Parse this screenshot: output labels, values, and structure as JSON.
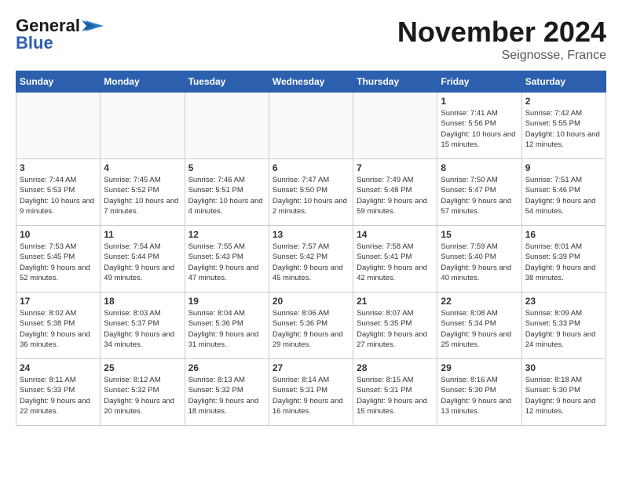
{
  "logo": {
    "general": "General",
    "blue": "Blue"
  },
  "header": {
    "month": "November 2024",
    "location": "Seignosse, France"
  },
  "weekdays": [
    "Sunday",
    "Monday",
    "Tuesday",
    "Wednesday",
    "Thursday",
    "Friday",
    "Saturday"
  ],
  "weeks": [
    [
      {
        "day": "",
        "info": ""
      },
      {
        "day": "",
        "info": ""
      },
      {
        "day": "",
        "info": ""
      },
      {
        "day": "",
        "info": ""
      },
      {
        "day": "",
        "info": ""
      },
      {
        "day": "1",
        "info": "Sunrise: 7:41 AM\nSunset: 5:56 PM\nDaylight: 10 hours and 15 minutes."
      },
      {
        "day": "2",
        "info": "Sunrise: 7:42 AM\nSunset: 5:55 PM\nDaylight: 10 hours and 12 minutes."
      }
    ],
    [
      {
        "day": "3",
        "info": "Sunrise: 7:44 AM\nSunset: 5:53 PM\nDaylight: 10 hours and 9 minutes."
      },
      {
        "day": "4",
        "info": "Sunrise: 7:45 AM\nSunset: 5:52 PM\nDaylight: 10 hours and 7 minutes."
      },
      {
        "day": "5",
        "info": "Sunrise: 7:46 AM\nSunset: 5:51 PM\nDaylight: 10 hours and 4 minutes."
      },
      {
        "day": "6",
        "info": "Sunrise: 7:47 AM\nSunset: 5:50 PM\nDaylight: 10 hours and 2 minutes."
      },
      {
        "day": "7",
        "info": "Sunrise: 7:49 AM\nSunset: 5:48 PM\nDaylight: 9 hours and 59 minutes."
      },
      {
        "day": "8",
        "info": "Sunrise: 7:50 AM\nSunset: 5:47 PM\nDaylight: 9 hours and 57 minutes."
      },
      {
        "day": "9",
        "info": "Sunrise: 7:51 AM\nSunset: 5:46 PM\nDaylight: 9 hours and 54 minutes."
      }
    ],
    [
      {
        "day": "10",
        "info": "Sunrise: 7:53 AM\nSunset: 5:45 PM\nDaylight: 9 hours and 52 minutes."
      },
      {
        "day": "11",
        "info": "Sunrise: 7:54 AM\nSunset: 5:44 PM\nDaylight: 9 hours and 49 minutes."
      },
      {
        "day": "12",
        "info": "Sunrise: 7:55 AM\nSunset: 5:43 PM\nDaylight: 9 hours and 47 minutes."
      },
      {
        "day": "13",
        "info": "Sunrise: 7:57 AM\nSunset: 5:42 PM\nDaylight: 9 hours and 45 minutes."
      },
      {
        "day": "14",
        "info": "Sunrise: 7:58 AM\nSunset: 5:41 PM\nDaylight: 9 hours and 42 minutes."
      },
      {
        "day": "15",
        "info": "Sunrise: 7:59 AM\nSunset: 5:40 PM\nDaylight: 9 hours and 40 minutes."
      },
      {
        "day": "16",
        "info": "Sunrise: 8:01 AM\nSunset: 5:39 PM\nDaylight: 9 hours and 38 minutes."
      }
    ],
    [
      {
        "day": "17",
        "info": "Sunrise: 8:02 AM\nSunset: 5:38 PM\nDaylight: 9 hours and 36 minutes."
      },
      {
        "day": "18",
        "info": "Sunrise: 8:03 AM\nSunset: 5:37 PM\nDaylight: 9 hours and 34 minutes."
      },
      {
        "day": "19",
        "info": "Sunrise: 8:04 AM\nSunset: 5:36 PM\nDaylight: 9 hours and 31 minutes."
      },
      {
        "day": "20",
        "info": "Sunrise: 8:06 AM\nSunset: 5:36 PM\nDaylight: 9 hours and 29 minutes."
      },
      {
        "day": "21",
        "info": "Sunrise: 8:07 AM\nSunset: 5:35 PM\nDaylight: 9 hours and 27 minutes."
      },
      {
        "day": "22",
        "info": "Sunrise: 8:08 AM\nSunset: 5:34 PM\nDaylight: 9 hours and 25 minutes."
      },
      {
        "day": "23",
        "info": "Sunrise: 8:09 AM\nSunset: 5:33 PM\nDaylight: 9 hours and 24 minutes."
      }
    ],
    [
      {
        "day": "24",
        "info": "Sunrise: 8:11 AM\nSunset: 5:33 PM\nDaylight: 9 hours and 22 minutes."
      },
      {
        "day": "25",
        "info": "Sunrise: 8:12 AM\nSunset: 5:32 PM\nDaylight: 9 hours and 20 minutes."
      },
      {
        "day": "26",
        "info": "Sunrise: 8:13 AM\nSunset: 5:32 PM\nDaylight: 9 hours and 18 minutes."
      },
      {
        "day": "27",
        "info": "Sunrise: 8:14 AM\nSunset: 5:31 PM\nDaylight: 9 hours and 16 minutes."
      },
      {
        "day": "28",
        "info": "Sunrise: 8:15 AM\nSunset: 5:31 PM\nDaylight: 9 hours and 15 minutes."
      },
      {
        "day": "29",
        "info": "Sunrise: 8:16 AM\nSunset: 5:30 PM\nDaylight: 9 hours and 13 minutes."
      },
      {
        "day": "30",
        "info": "Sunrise: 8:18 AM\nSunset: 5:30 PM\nDaylight: 9 hours and 12 minutes."
      }
    ]
  ]
}
